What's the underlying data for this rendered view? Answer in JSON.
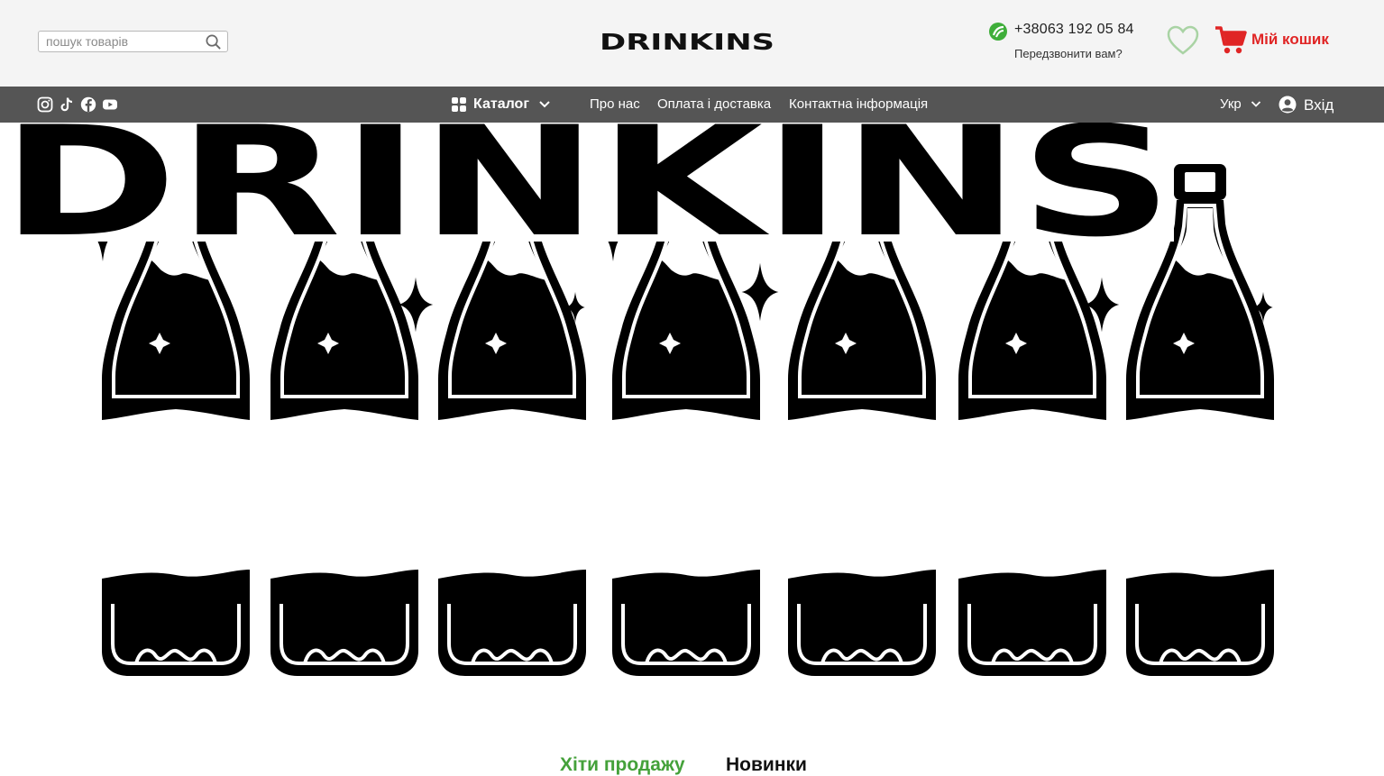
{
  "header": {
    "search_placeholder": "пошук товарів",
    "phone": "+38063 192 05 84",
    "callback": "Передзвонити вам?",
    "cart_label": "Мій кошик"
  },
  "nav": {
    "catalog": "Каталог",
    "links": [
      "Про нас",
      "Оплата і доставка",
      "Контактна інформація"
    ],
    "language": "Укр",
    "login": "Вхід",
    "social": [
      "instagram-icon",
      "tiktok-icon",
      "facebook-icon",
      "youtube-icon"
    ]
  },
  "logo_text": "DRINKINS",
  "hero": {
    "wordmark": "DRINKINS"
  },
  "tabs": [
    {
      "label": "Хіти продажу",
      "active": true
    },
    {
      "label": "Новинки",
      "active": false
    }
  ],
  "colors": {
    "topbar_bg": "#f4f4f4",
    "navbar_bg": "#555555",
    "cart_red": "#e02525",
    "accent_green": "#44a13a",
    "heart_green": "#a9d3a4"
  }
}
